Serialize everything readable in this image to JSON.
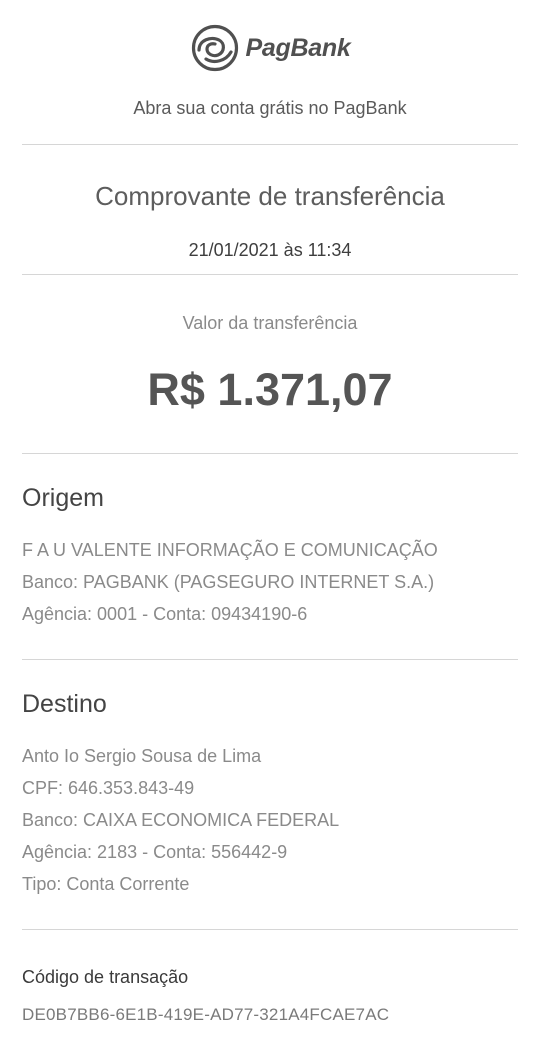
{
  "header": {
    "brand_name": "PagBank",
    "logo_icon": "pagbank-logo-icon",
    "tagline": "Abra sua conta grátis no PagBank"
  },
  "receipt": {
    "title": "Comprovante de transferência",
    "datetime": "21/01/2021 às 11:34",
    "amount_label": "Valor da transferência",
    "amount": "R$ 1.371,07"
  },
  "origin": {
    "title": "Origem",
    "lines": [
      "F A U VALENTE INFORMAÇÃO E COMUNICAÇÃO",
      "Banco: PAGBANK (PAGSEGURO INTERNET S.A.)",
      "Agência: 0001 - Conta: 09434190-6"
    ]
  },
  "destination": {
    "title": "Destino",
    "lines": [
      "Anto Io Sergio Sousa de Lima",
      "CPF: 646.353.843-49",
      "Banco: CAIXA ECONOMICA FEDERAL",
      "Agência: 2183 - Conta: 556442-9",
      "Tipo: Conta Corrente"
    ]
  },
  "transaction": {
    "label": "Código de transação",
    "code": "DE0B7BB6-6E1B-419E-AD77-321A4FCAE7AC"
  },
  "colors": {
    "text_dark": "#444444",
    "text_muted": "#8a8a8a",
    "divider": "#d6d6d6"
  }
}
